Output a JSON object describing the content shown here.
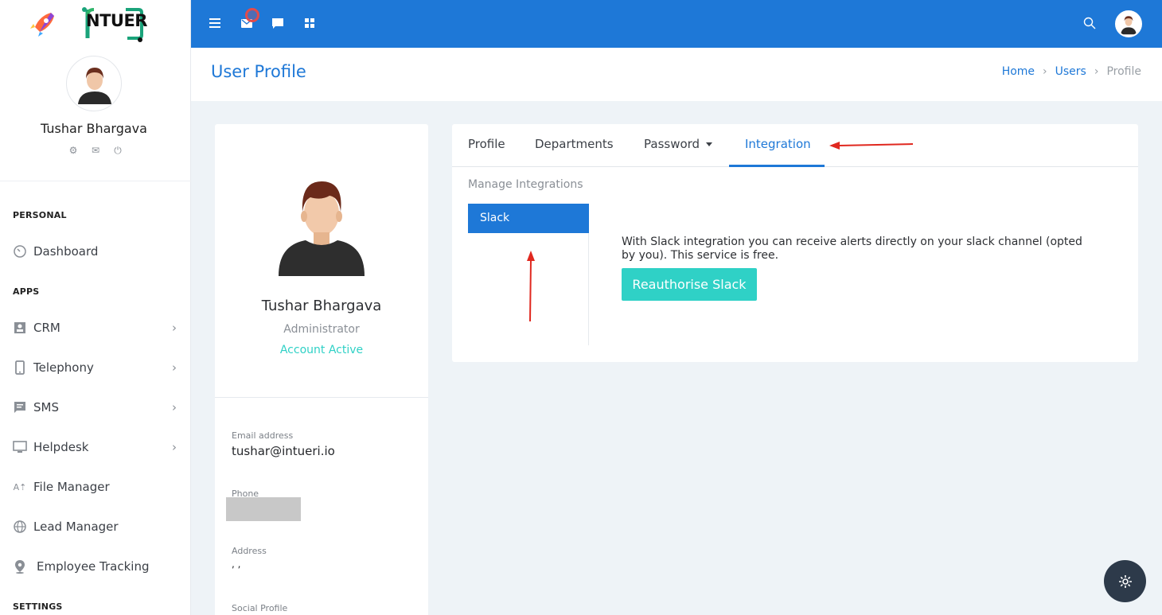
{
  "brand": {
    "logo_text": "NTUER"
  },
  "sidebar": {
    "user_name": "Tushar Bhargava",
    "section_personal": "PERSONAL",
    "section_apps": "APPS",
    "section_settings": "SETTINGS",
    "items": [
      {
        "label": "Dashboard",
        "icon": "dashboard-icon"
      },
      {
        "label": "CRM",
        "icon": "contact-card-icon"
      },
      {
        "label": "Telephony",
        "icon": "phone-icon"
      },
      {
        "label": "SMS",
        "icon": "message-icon"
      },
      {
        "label": "Helpdesk",
        "icon": "monitor-icon"
      },
      {
        "label": "File Manager",
        "icon": "file-upload-icon"
      },
      {
        "label": "Lead Manager",
        "icon": "globe-icon"
      },
      {
        "label": "Employee Tracking",
        "icon": "location-pin-icon"
      }
    ]
  },
  "header": {
    "title": "User Profile",
    "breadcrumb": [
      "Home",
      "Users",
      "Profile"
    ]
  },
  "profile_card": {
    "name": "Tushar Bhargava",
    "role": "Administrator",
    "status": "Account Active",
    "email_label": "Email address",
    "email_value": "tushar@intueri.io",
    "phone_label": "Phone",
    "address_label": "Address",
    "address_value": ", ,",
    "social_label": "Social Profile"
  },
  "integration_card": {
    "tabs": [
      "Profile",
      "Departments",
      "Password",
      "Integration"
    ],
    "active_tab": "Integration",
    "manage_label": "Manage Integrations",
    "menu_items": [
      "Slack"
    ],
    "description": "With Slack integration you can receive alerts directly on your slack channel (opted by you). This service is free.",
    "button_label": "Reauthorise Slack"
  },
  "colors": {
    "primary": "#1e78d7",
    "teal": "#2fd1c6",
    "annotation": "#e0281f"
  }
}
